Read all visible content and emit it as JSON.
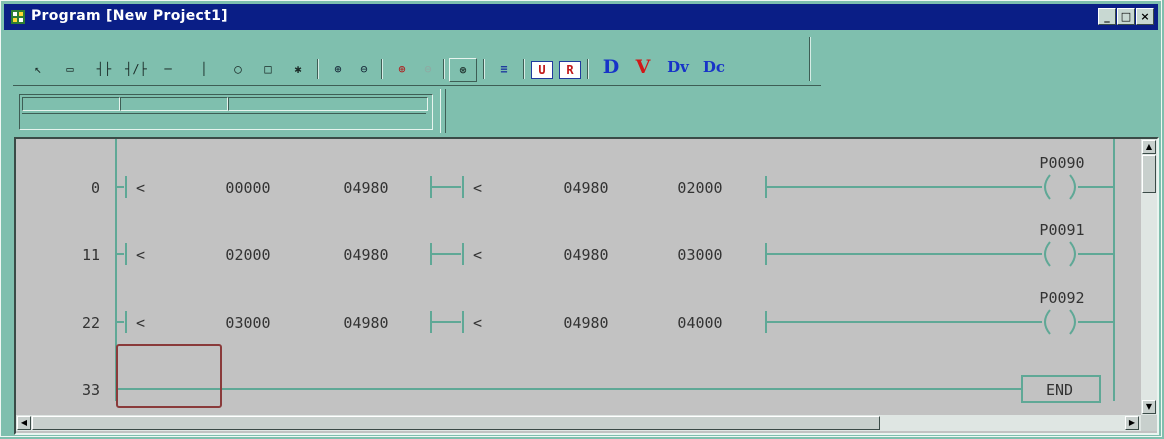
{
  "window": {
    "title": "Program [New Project1]",
    "controls": [
      "minimize",
      "maximize",
      "close"
    ]
  },
  "toolbar": {
    "tools": [
      {
        "name": "select-arrow-icon",
        "glyph": "↖"
      },
      {
        "name": "rectangle-select-icon",
        "glyph": "▭"
      },
      {
        "name": "normally-open-contact-icon",
        "glyph": "┤├"
      },
      {
        "name": "normally-closed-contact-icon",
        "glyph": "┤/├"
      },
      {
        "name": "horizontal-line-icon",
        "glyph": "─"
      },
      {
        "name": "vertical-line-icon",
        "glyph": "│"
      },
      {
        "name": "coil-icon",
        "glyph": "◯"
      },
      {
        "name": "function-block-icon",
        "glyph": "□"
      },
      {
        "name": "invert-icon",
        "glyph": "✱"
      },
      {
        "name": "zoom-in-icon",
        "glyph": "⊕"
      },
      {
        "name": "zoom-out-icon",
        "glyph": "⊖"
      },
      {
        "name": "zoom-in-red-icon",
        "glyph": "⊕"
      },
      {
        "name": "zoom-out-disabled-icon",
        "glyph": "⊖"
      },
      {
        "name": "zoom-fit-icon",
        "glyph": "⊛"
      },
      {
        "name": "comment-icon",
        "glyph": "≡"
      },
      {
        "name": "upload-icon",
        "glyph": "U"
      },
      {
        "name": "reset-icon",
        "glyph": "R"
      },
      {
        "name": "device-d-icon",
        "glyph": "D"
      },
      {
        "name": "device-v-icon",
        "glyph": "V"
      },
      {
        "name": "device-dv-icon",
        "glyph": "Dv"
      },
      {
        "name": "device-dc-icon",
        "glyph": "Dc"
      }
    ]
  },
  "tabs": [
    "",
    "",
    ""
  ],
  "ladder": {
    "rungs": [
      {
        "step": "0",
        "op1": "<",
        "a1": "00000",
        "b1": "04980",
        "op2": "<",
        "a2": "04980",
        "b2": "02000",
        "coil": "P0090"
      },
      {
        "step": "11",
        "op1": "<",
        "a1": "02000",
        "b1": "04980",
        "op2": "<",
        "a2": "04980",
        "b2": "03000",
        "coil": "P0091"
      },
      {
        "step": "22",
        "op1": "<",
        "a1": "03000",
        "b1": "04980",
        "op2": "<",
        "a2": "04980",
        "b2": "04000",
        "coil": "P0092"
      }
    ],
    "end_step": "33",
    "end_label": "END"
  },
  "colors": {
    "titlebar": "#0a1e86",
    "window_bg": "#7fbfae",
    "editor_bg": "#c2c2c2",
    "rung_line": "#5fa896",
    "cursor": "#8a3a3a"
  }
}
